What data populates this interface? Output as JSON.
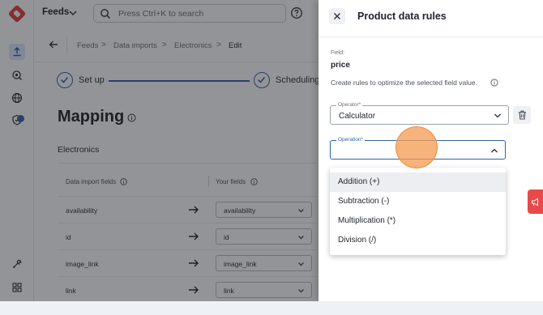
{
  "header": {
    "feeds_label": "Feeds",
    "search_placeholder": "Press Ctrl+K to search"
  },
  "breadcrumb": [
    "Feeds",
    "Data imports",
    "Electronics",
    "Edit"
  ],
  "breadcrumb_separator": ">",
  "stepper": {
    "steps": [
      "Set up",
      "Scheduling"
    ]
  },
  "page": {
    "title": "Mapping",
    "subtitle": "Electronics"
  },
  "table": {
    "headers": [
      "Data import fields",
      "Your fields"
    ],
    "rows": [
      {
        "import_field": "availability",
        "your_field": "availability"
      },
      {
        "import_field": "id",
        "your_field": "id"
      },
      {
        "import_field": "image_link",
        "your_field": "image_link"
      },
      {
        "import_field": "link",
        "your_field": "link"
      }
    ]
  },
  "drawer": {
    "title": "Product data rules",
    "field_caption": "Field:",
    "field_value": "price",
    "description": "Create rules to optimize the selected field value.",
    "operator_label": "Operator*",
    "operator_value": "Calculator",
    "operation_label": "Operation*",
    "operation_value": "",
    "operation_options": [
      "Addition (+)",
      "Subtraction (-)",
      "Multiplication (*)",
      "Division (/)"
    ],
    "hovered_option": "Addition (+)"
  },
  "colors": {
    "brand_red": "#e23e3e",
    "accent_blue": "#3161ad",
    "cursor_highlight": "#f39e56",
    "feedback_tab": "#e84a4a"
  },
  "icons": {
    "logo": "logo-icon",
    "search": "search-icon",
    "help": "help-icon",
    "close": "close-icon",
    "trash": "trash-icon",
    "info": "info-icon",
    "arrow": "arrow-right-icon",
    "chevron": "chevron-down-icon",
    "feedback": "megaphone-icon"
  }
}
